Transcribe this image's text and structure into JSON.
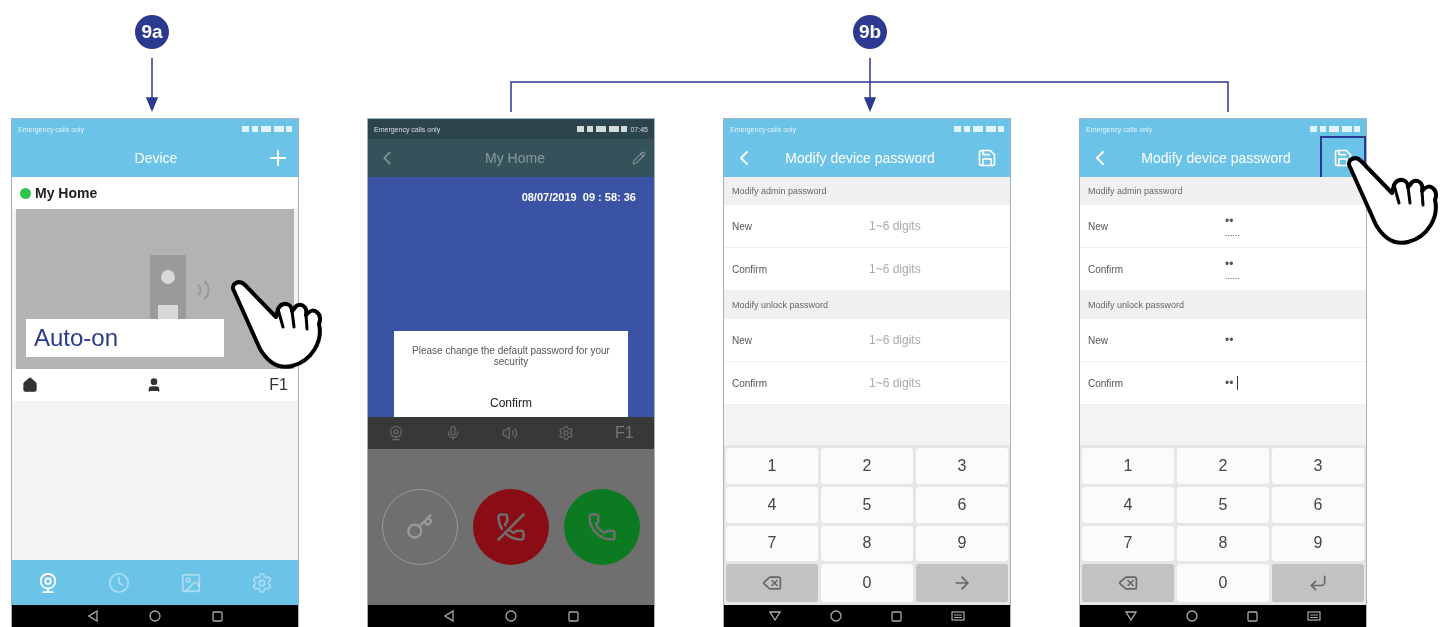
{
  "annotations": [
    {
      "label": "9a"
    },
    {
      "label": "9b"
    }
  ],
  "screens": [
    {
      "kind": "device",
      "status": {
        "carrier": "Emergency calls only"
      },
      "title": "Device",
      "device": {
        "name": "My Home",
        "color": "#2fc44a",
        "overlay_label": "Auto-on",
        "function_label": "F1"
      },
      "pointer": true,
      "tabs": [
        {
          "kind": "camera",
          "selected": true
        },
        {
          "kind": "clock",
          "selected": false
        },
        {
          "kind": "picture",
          "selected": false
        },
        {
          "kind": "gear",
          "selected": false
        }
      ]
    },
    {
      "kind": "call",
      "status": {
        "carrier": "Emergency calls only",
        "time": "07:45"
      },
      "title": "My Home",
      "timestamp": "08/07/2019  09 : 58: 36",
      "dialog": {
        "message": "Please change the default password for your security",
        "button": "Confirm"
      },
      "function_label": "F1"
    },
    {
      "kind": "password",
      "status": {
        "carrier": "Emergency calls only"
      },
      "title": "Modify device password",
      "sections": [
        {
          "title": "Modify admin password",
          "fields": [
            {
              "label": "New",
              "placeholder": "1~6 digits"
            },
            {
              "label": "Confirm",
              "placeholder": "1~6 digits"
            }
          ]
        },
        {
          "title": "Modify unlock password",
          "fields": [
            {
              "label": "New",
              "placeholder": "1~6 digits"
            },
            {
              "label": "Confirm",
              "placeholder": "1~6 digits"
            }
          ]
        }
      ],
      "keys": [
        {
          "kind": "digit",
          "label": "1"
        },
        {
          "kind": "digit",
          "label": "2"
        },
        {
          "kind": "digit",
          "label": "3"
        },
        {
          "kind": "digit",
          "label": "4"
        },
        {
          "kind": "digit",
          "label": "5"
        },
        {
          "kind": "digit",
          "label": "6"
        },
        {
          "kind": "digit",
          "label": "7"
        },
        {
          "kind": "digit",
          "label": "8"
        },
        {
          "kind": "digit",
          "label": "9"
        },
        {
          "kind": "delete"
        },
        {
          "kind": "digit",
          "label": "0"
        },
        {
          "kind": "next"
        }
      ]
    },
    {
      "kind": "password",
      "status": {
        "carrier": "Emergency calls only"
      },
      "title": "Modify device password",
      "save_highlighted": true,
      "pointer": true,
      "sections": [
        {
          "title": "Modify admin password",
          "fields": [
            {
              "label": "New",
              "value": "••",
              "hint": "......"
            },
            {
              "label": "Confirm",
              "value": "••",
              "hint": "......"
            }
          ]
        },
        {
          "title": "Modify unlock password",
          "fields": [
            {
              "label": "New",
              "value": "••"
            },
            {
              "label": "Confirm",
              "value": "••",
              "focused": true
            }
          ]
        }
      ],
      "keys": [
        {
          "kind": "digit",
          "label": "1"
        },
        {
          "kind": "digit",
          "label": "2"
        },
        {
          "kind": "digit",
          "label": "3"
        },
        {
          "kind": "digit",
          "label": "4"
        },
        {
          "kind": "digit",
          "label": "5"
        },
        {
          "kind": "digit",
          "label": "6"
        },
        {
          "kind": "digit",
          "label": "7"
        },
        {
          "kind": "digit",
          "label": "8"
        },
        {
          "kind": "digit",
          "label": "9"
        },
        {
          "kind": "delete"
        },
        {
          "kind": "digit",
          "label": "0"
        },
        {
          "kind": "enter"
        }
      ]
    }
  ]
}
